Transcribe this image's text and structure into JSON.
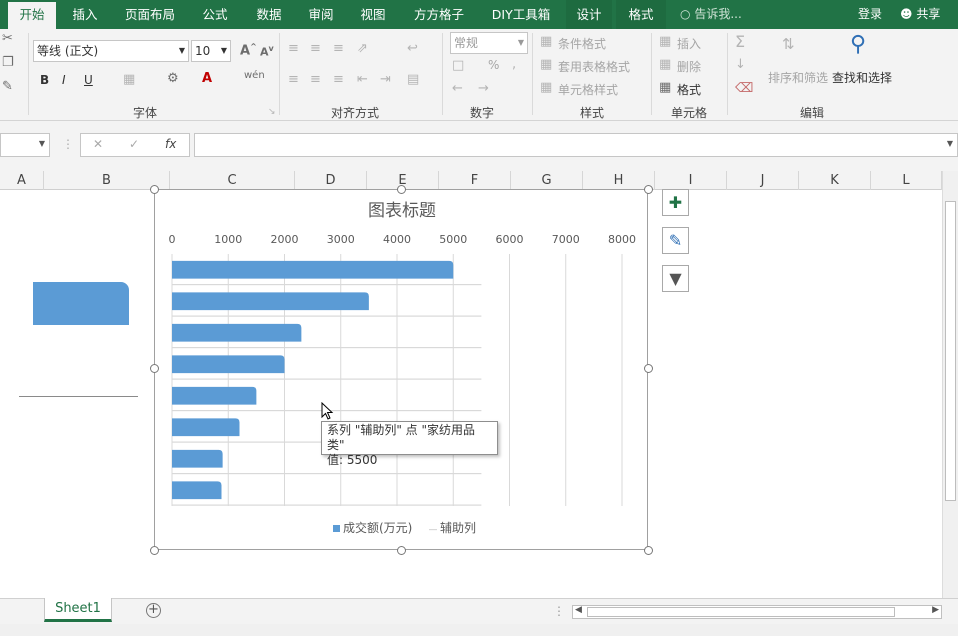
{
  "ribbon_tabs": {
    "home": "开始",
    "insert": "插入",
    "page_layout": "页面布局",
    "formulas": "公式",
    "data": "数据",
    "review": "审阅",
    "view": "视图",
    "fangfang": "方方格子",
    "diy": "DIY工具箱",
    "design": "设计",
    "format": "格式",
    "tell_me": "告诉我...",
    "login": "登录",
    "share": "共享"
  },
  "font_group": {
    "font_name": "等线 (正文)",
    "font_size": "10",
    "bold": "B",
    "italic": "I",
    "underline": "U",
    "label": "字体"
  },
  "align_group": {
    "label": "对齐方式"
  },
  "number_group": {
    "format_value": "常规",
    "percent": "%",
    "label": "数字"
  },
  "styles_group": {
    "conditional": "条件格式",
    "table": "套用表格格式",
    "cell_style": "单元格样式",
    "label": "样式"
  },
  "cells_group": {
    "insert": "插入",
    "delete": "删除",
    "format": "格式",
    "label": "单元格"
  },
  "edit_group": {
    "sort_filter": "排序和筛选",
    "find_select": "查找和选择",
    "label": "编辑"
  },
  "formula_bar": {
    "fx": "fx"
  },
  "columns": [
    "A",
    "B",
    "C",
    "D",
    "E",
    "F",
    "G",
    "H",
    "I",
    "J",
    "K",
    "L"
  ],
  "chart_data": {
    "type": "bar",
    "title": "图表标题",
    "xlim": [
      0,
      8000
    ],
    "x_ticks": [
      "0",
      "1000",
      "2000",
      "3000",
      "4000",
      "5000",
      "6000",
      "7000",
      "8000"
    ],
    "series": [
      {
        "name": "成交额(万元)",
        "values": [
          5000,
          3500,
          2300,
          2000,
          1500,
          1200,
          900,
          880
        ]
      },
      {
        "name": "辅助列",
        "values": [
          5500,
          5500,
          5500,
          5500,
          5500,
          5500,
          5500,
          5500
        ]
      }
    ],
    "legend_position": "bottom",
    "grid": true,
    "colors": {
      "primary": "#5b9bd5",
      "secondary": "#d9d9d9"
    }
  },
  "tooltip": {
    "line1": "系列 \"辅助列\" 点 \"家纺用品类\"",
    "line2": "值: 5500"
  },
  "sheet": {
    "name": "Sheet1",
    "add": "+"
  }
}
